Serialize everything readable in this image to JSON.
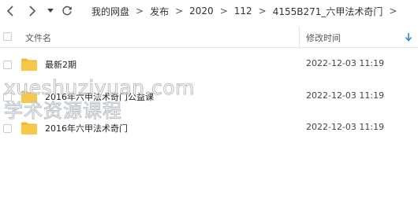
{
  "breadcrumb": [
    {
      "label": "我的网盘"
    },
    {
      "label": "发布"
    },
    {
      "label": "2020"
    },
    {
      "label": "112"
    },
    {
      "label": "4155B271_六甲法术奇门"
    }
  ],
  "columns": {
    "name": "文件名",
    "date": "修改时间"
  },
  "files": [
    {
      "name": "最新2期",
      "date": "2022-12-03 11:19",
      "type": "folder"
    },
    {
      "name": "2016年六甲法术奇门公益课",
      "date": "2022-12-03 11:19",
      "type": "folder"
    },
    {
      "name": "2016年六甲法术奇门",
      "date": "2022-12-03 11:19",
      "type": "folder"
    }
  ],
  "watermark": {
    "line1": "xueshuziyuan.com",
    "line2": "学术资源课程"
  },
  "colors": {
    "folder": "#f7c94b",
    "folder_tab": "#f2b735",
    "sort_accent": "#2a7fd8",
    "header_text": "#555555"
  },
  "icons": {
    "back": "chevron-left-icon",
    "forward": "chevron-right-icon",
    "history": "caret-down-icon",
    "refresh": "refresh-icon",
    "sort": "sort-arrow-down-icon",
    "folder": "folder-icon"
  }
}
